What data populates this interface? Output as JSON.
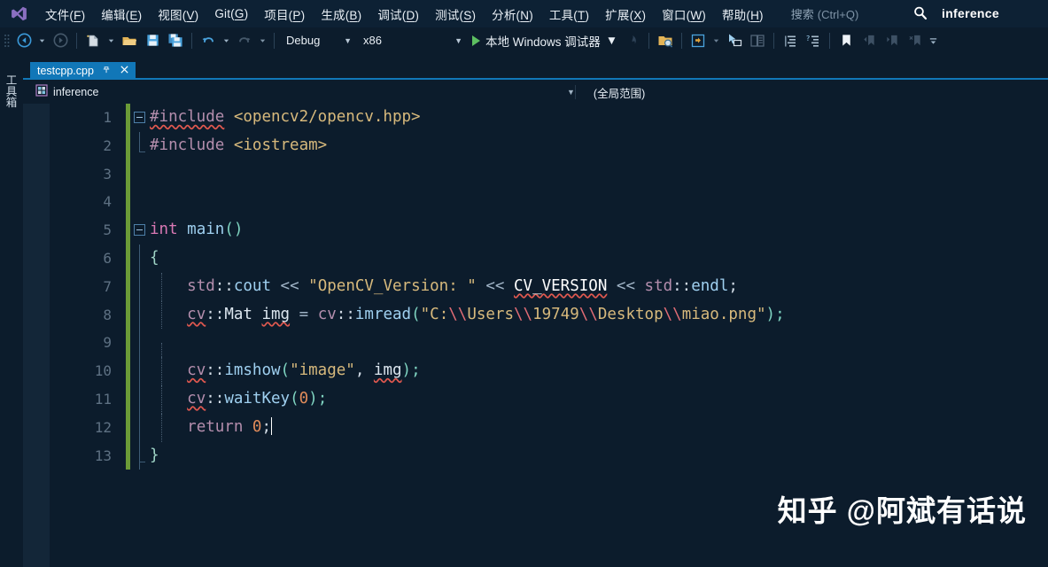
{
  "window": {
    "app_title": "inference",
    "logo_icon": "visual-studio-logo"
  },
  "menubar": {
    "items": [
      {
        "label": "文件(F)",
        "text": "文件(",
        "accel": "F",
        "tail": ")"
      },
      {
        "label": "编辑(E)",
        "text": "编辑(",
        "accel": "E",
        "tail": ")"
      },
      {
        "label": "视图(V)",
        "text": "视图(",
        "accel": "V",
        "tail": ")"
      },
      {
        "label": "Git(G)",
        "text": "Git(",
        "accel": "G",
        "tail": ")"
      },
      {
        "label": "项目(P)",
        "text": "项目(",
        "accel": "P",
        "tail": ")"
      },
      {
        "label": "生成(B)",
        "text": "生成(",
        "accel": "B",
        "tail": ")"
      },
      {
        "label": "调试(D)",
        "text": "调试(",
        "accel": "D",
        "tail": ")"
      },
      {
        "label": "测试(S)",
        "text": "测试(",
        "accel": "S",
        "tail": ")"
      },
      {
        "label": "分析(N)",
        "text": "分析(",
        "accel": "N",
        "tail": ")"
      },
      {
        "label": "工具(T)",
        "text": "工具(",
        "accel": "T",
        "tail": ")"
      },
      {
        "label": "扩展(X)",
        "text": "扩展(",
        "accel": "X",
        "tail": ")"
      },
      {
        "label": "窗口(W)",
        "text": "窗口(",
        "accel": "W",
        "tail": ")"
      },
      {
        "label": "帮助(H)",
        "text": "帮助(",
        "accel": "H",
        "tail": ")"
      }
    ],
    "search_label": "搜索",
    "search_hint": "(Ctrl+Q)",
    "search_icon": "magnifier-icon"
  },
  "toolbar": {
    "nav_back_icon": "navigate-back-icon",
    "nav_forward_icon": "navigate-forward-icon",
    "new_file_icon": "new-file-icon",
    "open_file_icon": "open-folder-icon",
    "save_icon": "save-icon",
    "save_all_icon": "save-all-icon",
    "undo_icon": "undo-icon",
    "redo_icon": "redo-icon",
    "config": "Debug",
    "platform": "x86",
    "run_label": "本地 Windows 调试器",
    "run_icon": "play-triangle-icon",
    "hotreload_icon": "hot-reload-icon",
    "solution_explorer_icon": "solution-explorer-search-icon",
    "live_share_icon": "live-share-icon",
    "pointer_icon": "pointer-select-icon",
    "compare_icon": "compare-files-icon",
    "indent_icon": "indent-icon",
    "indent2_icon": "indent-question-icon",
    "bookmark_icon": "bookmark-icon",
    "prev_bookmark_icon": "previous-bookmark-icon",
    "next_bookmark_icon": "next-bookmark-icon",
    "clear_bookmark_icon": "clear-bookmark-icon",
    "overflow_icon": "toolbar-overflow-icon"
  },
  "toolbox": {
    "label": "工具箱"
  },
  "tabs": {
    "active": "testcpp.cpp",
    "pin_icon": "pin-icon",
    "close_icon": "close-icon"
  },
  "navbar": {
    "project": "inference",
    "project_icon": "cpp-project-icon",
    "scope": "(全局范围)",
    "caret_icon": "chevron-down-icon"
  },
  "editor": {
    "lines": [
      {
        "n": "1"
      },
      {
        "n": "2"
      },
      {
        "n": "3"
      },
      {
        "n": "4"
      },
      {
        "n": "5"
      },
      {
        "n": "6"
      },
      {
        "n": "7"
      },
      {
        "n": "8"
      },
      {
        "n": "9"
      },
      {
        "n": "10"
      },
      {
        "n": "11"
      },
      {
        "n": "12"
      },
      {
        "n": "13"
      }
    ],
    "code": {
      "l1_pre": "#include",
      "l1_hdr": "<opencv2/opencv.hpp>",
      "l2_pre": "#include",
      "l2_hdr": "<iostream>",
      "l5_kw": "int",
      "l5_fn": "main",
      "l5_parens": "()",
      "l6_brace": "{",
      "l7_ns": "std",
      "l7_sep": "::",
      "l7_obj": "cout",
      "l7_op1": "<<",
      "l7_str": "\"OpenCV_Version: \"",
      "l7_op2": "<<",
      "l7_macro": "CV_VERSION",
      "l7_op3": "<<",
      "l7_ns2": "std",
      "l7_sep2": "::",
      "l7_endl": "endl",
      "l7_semi": ";",
      "l8_ns": "cv",
      "l8_sep": "::",
      "l8_type": "Mat",
      "l8_var": "img",
      "l8_eq": "=",
      "l8_ns2": "cv",
      "l8_sep2": "::",
      "l8_fn": "imread",
      "l8_str_a": "\"C:",
      "l8_esc1": "\\\\",
      "l8_str_b": "Users",
      "l8_esc2": "\\\\",
      "l8_str_c": "19749",
      "l8_esc3": "\\\\",
      "l8_str_d": "Desktop",
      "l8_esc4": "\\\\",
      "l8_str_e": "miao.png\"",
      "l8_tail": ");",
      "l10_ns": "cv",
      "l10_sep": "::",
      "l10_fn": "imshow",
      "l10_str": "\"image\"",
      "l10_comma": ", ",
      "l10_var": "img",
      "l10_tail": ");",
      "l11_ns": "cv",
      "l11_sep": "::",
      "l11_fn": "waitKey",
      "l11_num": "0",
      "l11_tail": ");",
      "l12_kw": "return",
      "l12_num": "0",
      "l12_semi": ";",
      "l13_brace": "}"
    }
  },
  "watermark": {
    "text": "知乎 @阿斌有话说"
  },
  "colors": {
    "accent": "#1177b8",
    "menubar_bg": "#0d2134",
    "editor_bg": "#0c1c2c",
    "change_bar": "#6b9b37",
    "run_green": "#5dbf61",
    "error_squiggle": "#e0584f"
  }
}
